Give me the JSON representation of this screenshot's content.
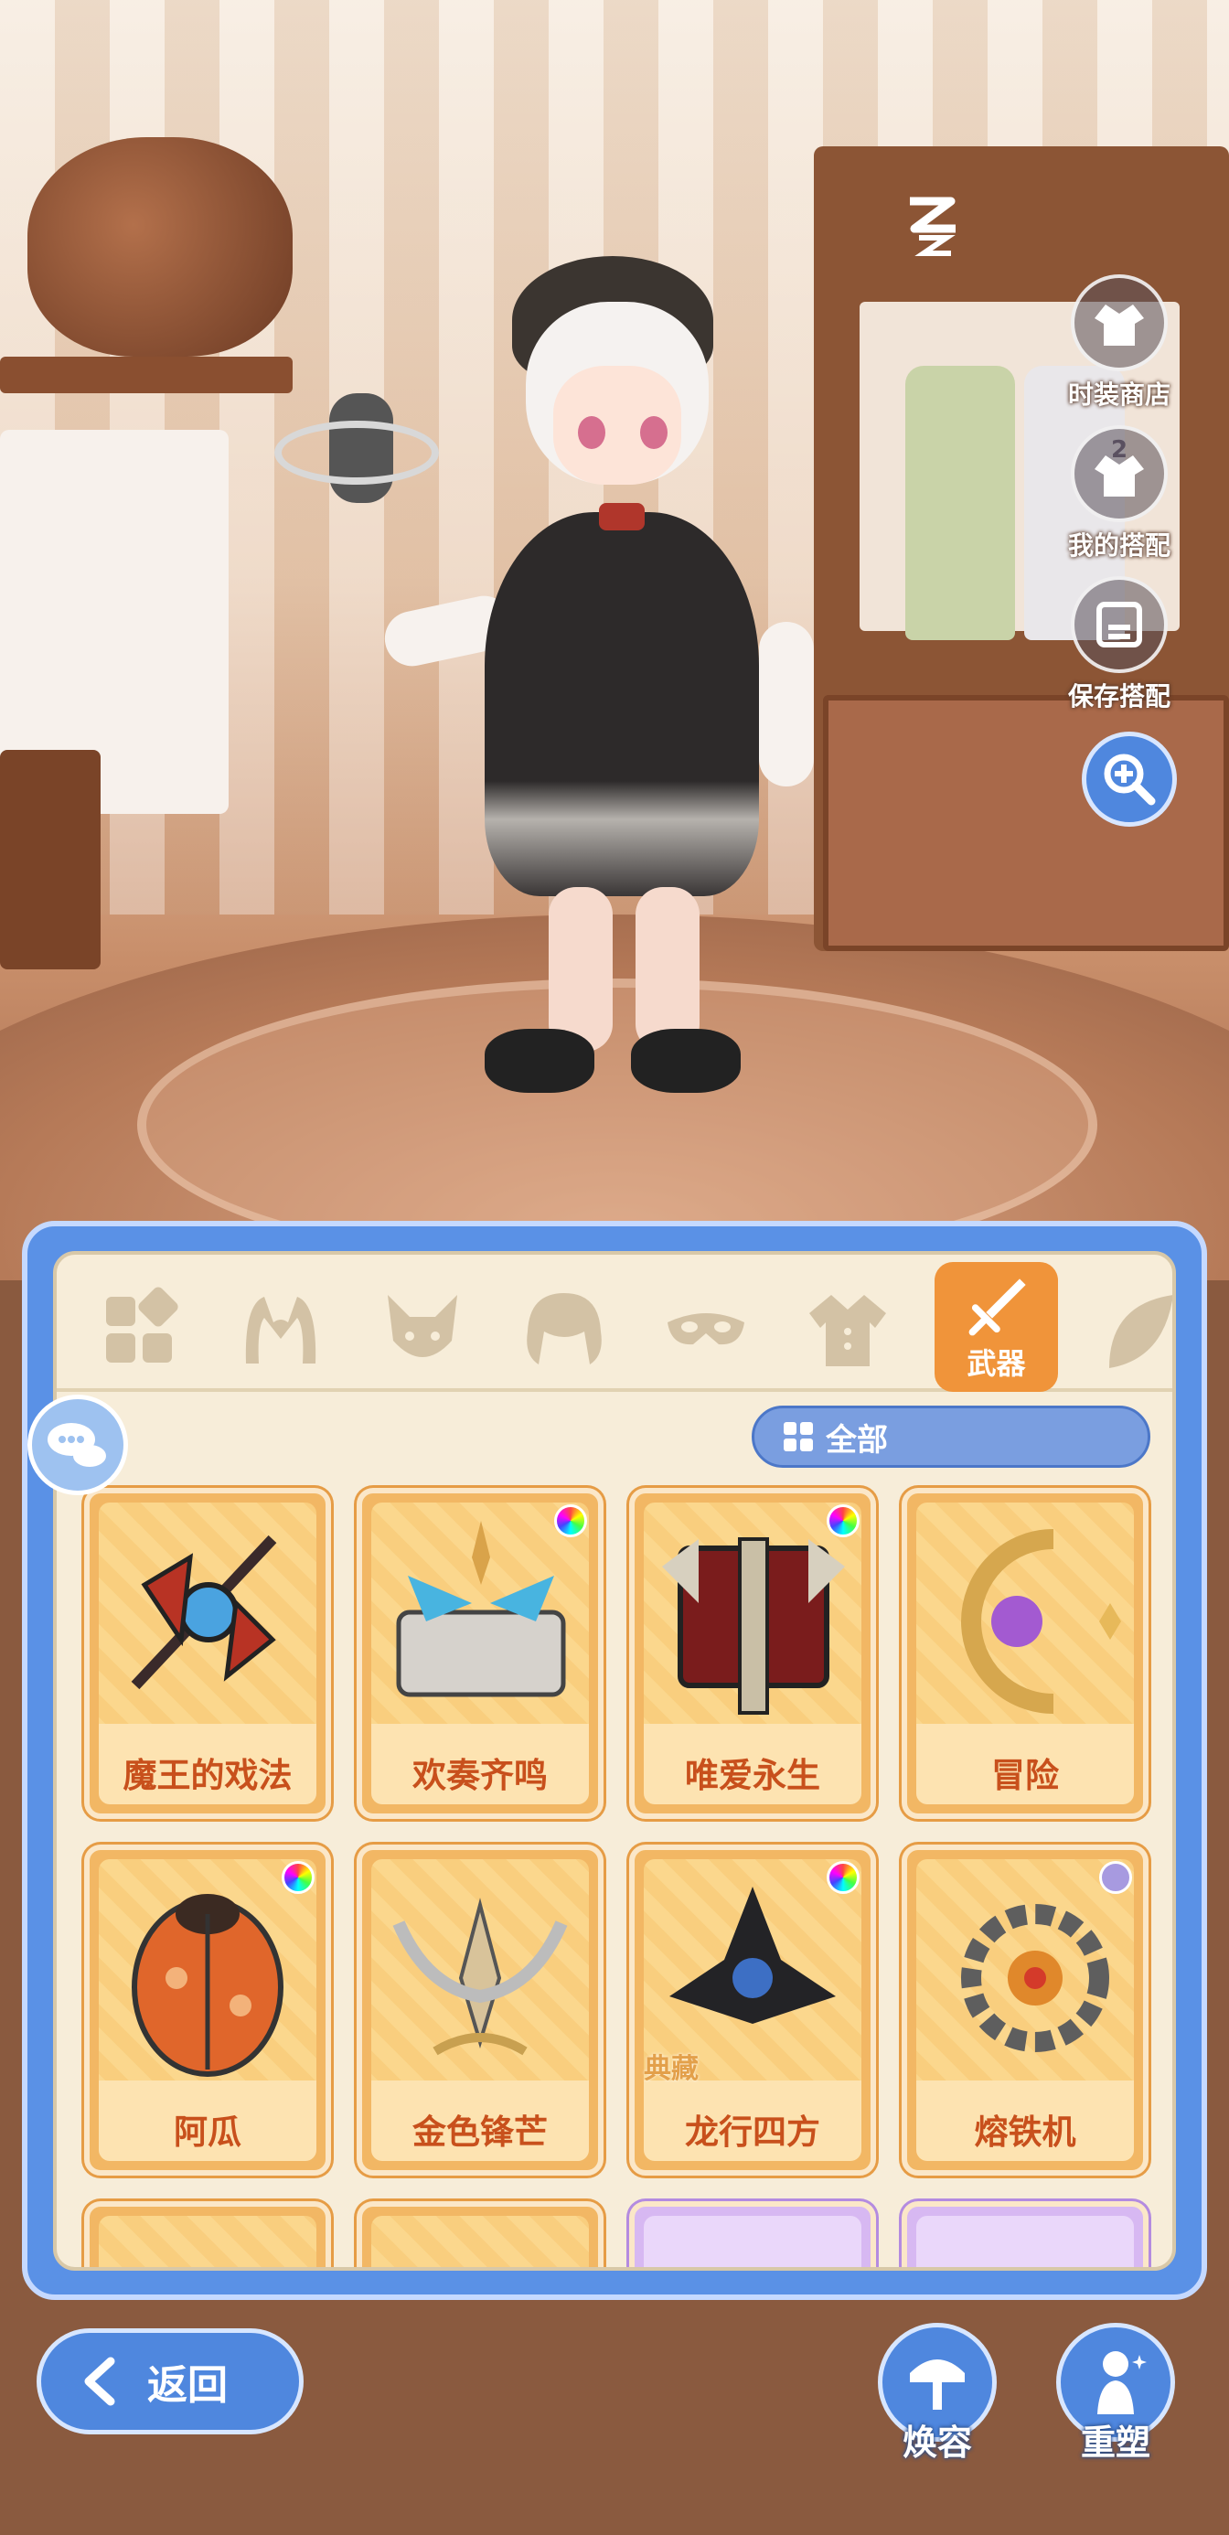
{
  "side_buttons": {
    "fashion_shop": "时装商店",
    "my_outfits": "我的搭配",
    "my_outfits_badge": "2",
    "save_outfit": "保存搭配"
  },
  "tabs": {
    "active_label": "武器",
    "items": [
      "all-category",
      "headwear",
      "face",
      "hair",
      "mask",
      "top",
      "weapon",
      "more"
    ]
  },
  "filter": {
    "label": "全部"
  },
  "items": [
    {
      "name": "魔王的戏法",
      "dye": "rainbow",
      "tag": ""
    },
    {
      "name": "欢奏齐鸣",
      "dye": "rainbow",
      "tag": ""
    },
    {
      "name": "唯爱永生",
      "dye": "rainbow",
      "tag": ""
    },
    {
      "name": "冒险",
      "dye": "",
      "tag": ""
    },
    {
      "name": "阿瓜",
      "dye": "rainbow",
      "tag": ""
    },
    {
      "name": "金色锋芒",
      "dye": "",
      "tag": ""
    },
    {
      "name": "龙行四方",
      "dye": "rainbow",
      "tag": "典藏"
    },
    {
      "name": "熔铁机",
      "dye": "plain",
      "tag": ""
    }
  ],
  "bottom": {
    "back": "返回",
    "face_change": "焕容",
    "reshape": "重塑"
  },
  "colors": {
    "accent_blue": "#4f87de",
    "active_tab": "#f0943a",
    "card_name": "#c8501c"
  }
}
